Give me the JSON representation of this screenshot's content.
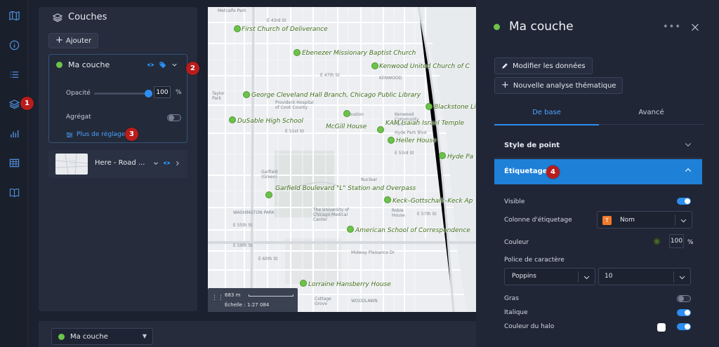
{
  "rail": {
    "items": [
      "map-icon",
      "info-icon",
      "list-icon",
      "layers-icon",
      "chart-icon",
      "table-icon",
      "book-icon"
    ],
    "marker": "1"
  },
  "layers_panel": {
    "title": "Couches",
    "add_label": "Ajouter",
    "layer": {
      "name": "Ma couche",
      "marker": "2",
      "opacity_label": "Opacité",
      "opacity_value": "100",
      "opacity_unit": "%",
      "aggregate_label": "Agrégat",
      "more_settings": "Plus de réglages",
      "more_marker": "3"
    },
    "basemap": {
      "name": "Here - Road ..."
    }
  },
  "map": {
    "pois": [
      "First Church of Deliverance",
      "Ebenezer Missionary Baptist Church",
      "Kenwood United Church of C",
      "George Cleveland Hall Branch, Chicago Public Library",
      "Blackstone Li",
      "KAM Isaiah Israel Temple",
      "DuSable High School",
      "McGill House",
      "Heller House",
      "Hyde Pa",
      "Garfield Boulevard \"L\" Station and Overpass",
      "Keck–Gottschalk–Keck Ap",
      "American School of Correspondence",
      "Lorraine Hansberry House"
    ],
    "streets": {
      "metcalfe": "Metcalfe Park",
      "e43": "E 43rd St",
      "e47": "E 47th St",
      "e51": "E 51st St",
      "kenwood": "KENWOOD",
      "provident": "Provident Hospital of Cook County",
      "washington_park": "WASHINGTON PARK",
      "e55": "E 55th St",
      "e53": "E 53rd St",
      "e57": "E 57th St",
      "e59": "E 59th St",
      "e60": "E 60th St",
      "midway": "Midway Plaisance Dr",
      "uchicago": "The University of Chicago Medical Center",
      "woodlawn": "WOODLAWN",
      "cottage": "Cottage Grove",
      "nuclear": "Nuclear",
      "robie": "Robie House",
      "hyde_park_blvd": "Hyde Park Blvd",
      "kenwood_ctr": "Kenwood Community Park",
      "garfield_green": "Garfield (Green)",
      "houston": "Houston",
      "taylor": "Taylor Park"
    },
    "scale_distance": "683 m",
    "scale_text": "Échelle : 1:27 084"
  },
  "right_panel": {
    "title": "Ma couche",
    "edit_data": "Modifier les données",
    "new_analysis": "Nouvelle analyse thématique",
    "tabs": [
      "De base",
      "Avancé"
    ],
    "sections": {
      "point_style": "Style de point",
      "labeling": "Étiquetage",
      "labeling_marker": "4"
    },
    "props": {
      "visible": "Visible",
      "label_column": "Colonne d'étiquetage",
      "label_column_value": "Nom",
      "color": "Couleur",
      "color_opacity": "100",
      "color_unit": "%",
      "font": "Police de caractère",
      "font_value": "Poppins",
      "font_size": "10",
      "bold": "Gras",
      "italic": "Italique",
      "halo_color": "Couleur du halo"
    }
  },
  "bottom_bar": {
    "layer_select": "Ma couche"
  },
  "colors": {
    "accent": "#2b8ef0",
    "poi": "#6cc24a",
    "marker": "#b91c1c",
    "section_open": "#1f80d8"
  }
}
